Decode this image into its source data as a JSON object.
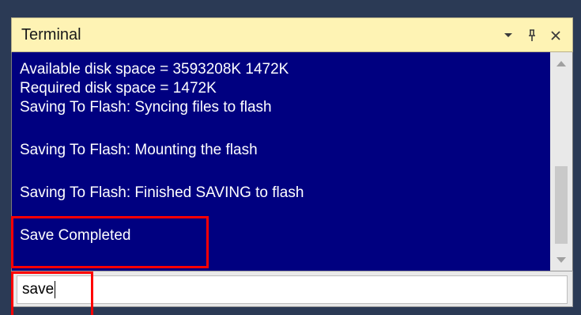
{
  "panel": {
    "title": "Terminal",
    "buttons": {
      "dropdown_icon": "chevron-down-icon",
      "pin_icon": "pin-icon",
      "close_icon": "close-icon"
    }
  },
  "terminal": {
    "lines": [
      "Available disk space = 3593208K 1472K",
      "Required disk space = 1472K",
      "Saving To Flash: Syncing files to flash",
      "",
      "Saving To Flash: Mounting the flash",
      "",
      "Saving To Flash: Finished SAVING to flash",
      "",
      "Save Completed"
    ]
  },
  "input": {
    "value": "save"
  },
  "colors": {
    "terminal_bg": "#000080",
    "titlebar_bg": "#fef3b4",
    "highlight": "#ff0000"
  }
}
